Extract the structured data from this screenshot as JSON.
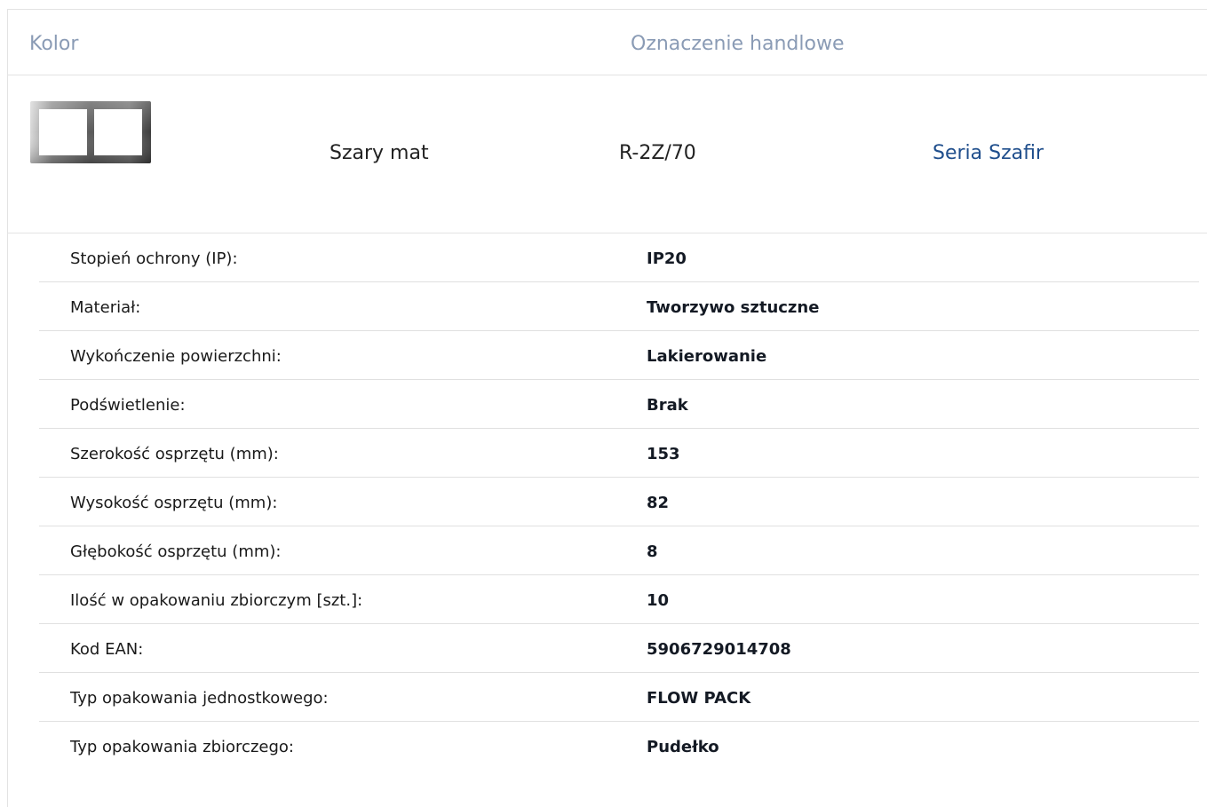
{
  "header": {
    "color_label": "Kolor",
    "trade_label": "Oznaczenie handlowe"
  },
  "product": {
    "thumbnail_icon": "double-frame-icon",
    "color_name": "Szary mat",
    "trade_code": "R-2Z/70",
    "series_link": "Seria Szafir",
    "series_link_color": "#1f4e8c",
    "header_color": "#8a9bb5"
  },
  "specs": [
    {
      "label": "Stopień ochrony (IP):",
      "value": "IP20"
    },
    {
      "label": "Materiał:",
      "value": "Tworzywo sztuczne"
    },
    {
      "label": "Wykończenie powierzchni:",
      "value": "Lakierowanie"
    },
    {
      "label": "Podświetlenie:",
      "value": "Brak"
    },
    {
      "label": "Szerokość osprzętu (mm):",
      "value": "153"
    },
    {
      "label": "Wysokość osprzętu (mm):",
      "value": "82"
    },
    {
      "label": "Głębokość osprzętu (mm):",
      "value": "8"
    },
    {
      "label": "Ilość w opakowaniu zbiorczym [szt.]:",
      "value": "10"
    },
    {
      "label": "Kod EAN:",
      "value": "5906729014708"
    },
    {
      "label": "Typ opakowania jednostkowego:",
      "value": "FLOW PACK"
    },
    {
      "label": "Typ opakowania zbiorczego:",
      "value": "Pudełko"
    }
  ]
}
